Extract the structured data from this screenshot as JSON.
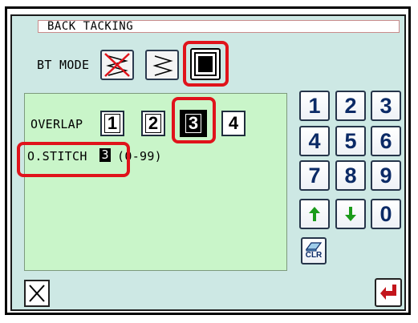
{
  "window": {
    "title": "BACK TACKING"
  },
  "bt_mode": {
    "label": "BT MODE",
    "options": [
      {
        "name": "off",
        "icon": "crossed-zigzag-icon",
        "selected": false
      },
      {
        "name": "zigzag",
        "icon": "zigzag-icon",
        "selected": false
      },
      {
        "name": "box",
        "icon": "box-stitch-icon",
        "selected": true
      }
    ]
  },
  "overlap": {
    "label": "OVERLAP",
    "options": [
      "1",
      "2",
      "3",
      "4"
    ],
    "selected": "3"
  },
  "o_stitch": {
    "label": "O.STITCH",
    "value": "3",
    "range_open": "(",
    "range_min_digit": "0",
    "range_rest": "-99)"
  },
  "keypad": {
    "keys": [
      "1",
      "2",
      "3",
      "4",
      "5",
      "6",
      "7",
      "8",
      "9"
    ],
    "up_icon": "arrow-up-icon",
    "down_icon": "arrow-down-icon",
    "zero": "0",
    "clear_label": "CLR"
  },
  "footer": {
    "cancel_icon": "close-icon",
    "enter_icon": "enter-return-icon"
  },
  "colors": {
    "highlight_outline": "#e0131b",
    "panel_bg": "#c9f5c9",
    "screen_bg": "#cde8e4",
    "digit_color": "#0b2a66",
    "arrow_green": "#1a9b1a",
    "enter_red": "#c3151c"
  }
}
